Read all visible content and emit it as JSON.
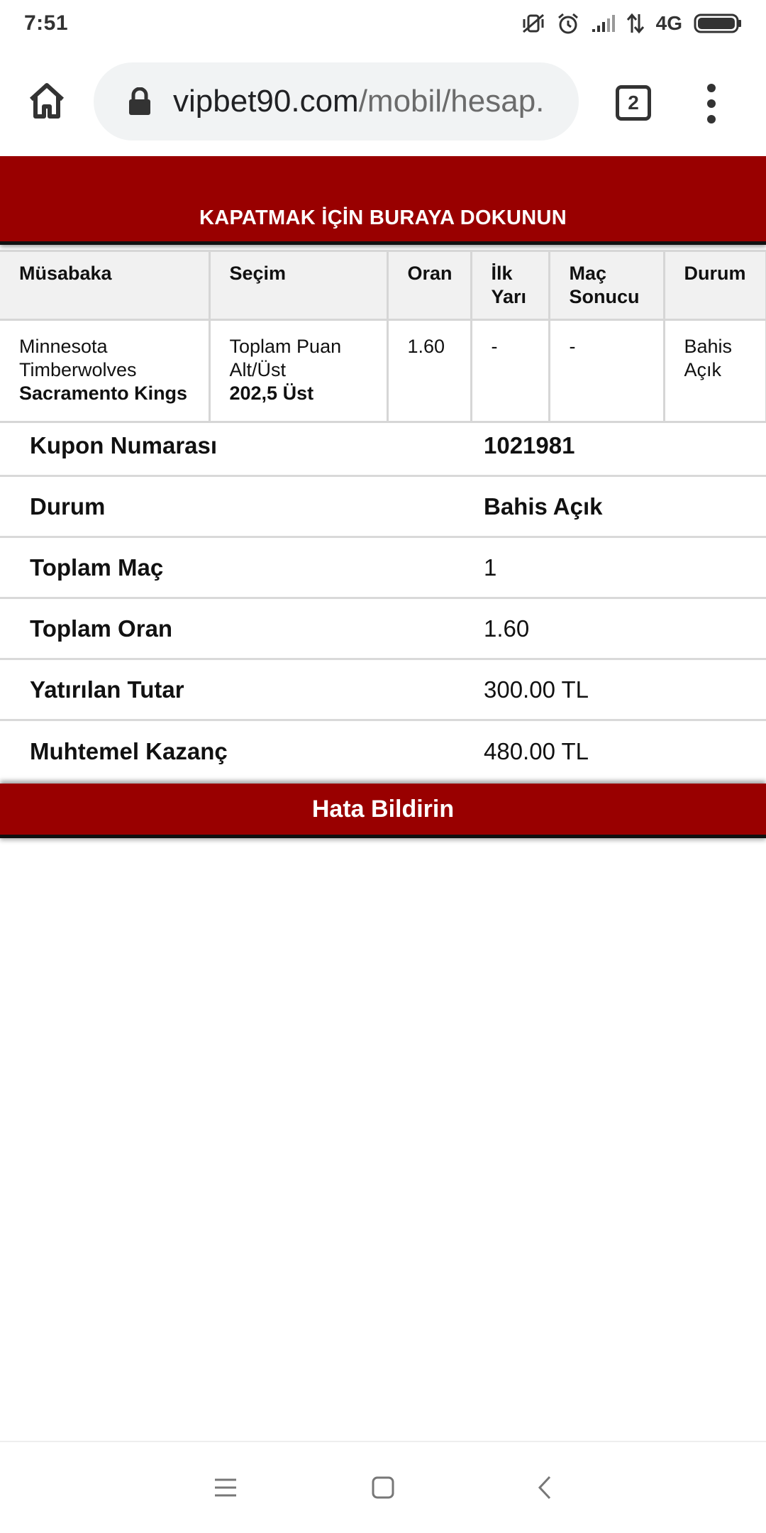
{
  "status_bar": {
    "time": "7:51",
    "network": "4G",
    "icons": [
      "vibrate-off-icon",
      "alarm-icon",
      "signal-icon",
      "data-arrows-icon",
      "battery-icon"
    ]
  },
  "browser": {
    "url_host": "vipbet90.com",
    "url_path": "/mobil/hesap.",
    "tab_count": "2",
    "icons": [
      "home-icon",
      "lock-icon",
      "more-vert-icon"
    ]
  },
  "banner": {
    "close_text": "KAPATMAK İÇİN BURAYA DOKUNUN",
    "color": "#990000"
  },
  "match_table": {
    "headers": {
      "event": "Müsabaka",
      "selection": "Seçim",
      "odds": "Oran",
      "first_half_line1": "İlk",
      "first_half_line2": "Yarı",
      "result_line1": "Maç",
      "result_line2": "Sonucu",
      "status": "Durum"
    },
    "row": {
      "team1_line1": "Minnesota",
      "team1_line2": "Timberwolves",
      "team2": "Sacramento Kings",
      "market_line1": "Toplam Puan",
      "market_line2": "Alt/Üst",
      "pick": "202,5 Üst",
      "odds": "1.60",
      "first_half": "-",
      "result": "-",
      "status_line1": "Bahis",
      "status_line2": "Açık"
    }
  },
  "info": {
    "coupon_label": "Kupon Numarası",
    "coupon_value": "1021981",
    "status_label": "Durum",
    "status_value": "Bahis Açık",
    "total_matches_label": "Toplam Maç",
    "total_matches_value": "1",
    "total_odds_label": "Toplam Oran",
    "total_odds_value": "1.60",
    "stake_label": "Yatırılan Tutar",
    "stake_value": "300.00 TL",
    "potential_win_label": "Muhtemel Kazanç",
    "potential_win_value": "480.00 TL"
  },
  "report": {
    "label": "Hata Bildirin"
  },
  "nav": {
    "icons": [
      "menu-icon",
      "home-square-icon",
      "back-icon"
    ]
  }
}
